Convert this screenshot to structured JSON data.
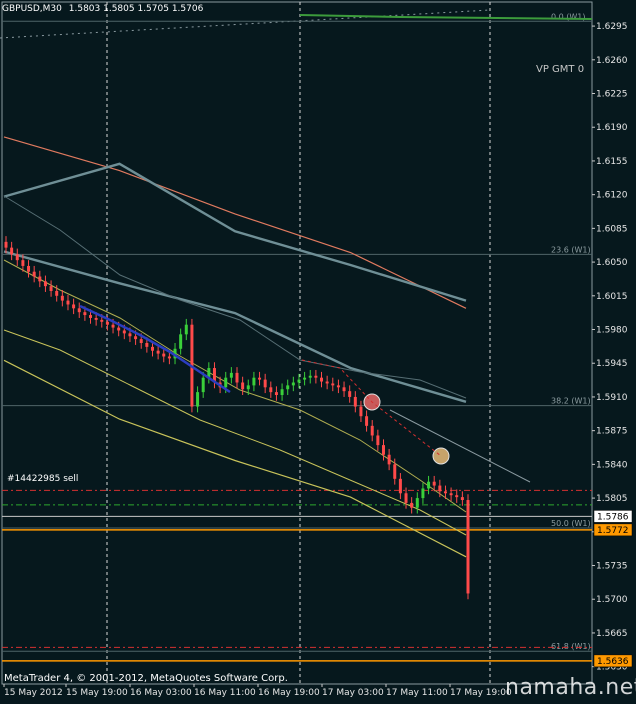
{
  "header": {
    "symbol": "GBPUSD,M30",
    "ohlc": "1.5803 1.5805 1.5705 1.5706"
  },
  "labels": {
    "vp": "VP GMT 0",
    "order": "#14422985 sell",
    "copyright": "MetaTrader 4, © 2001-2012, MetaQuotes Software Corp.",
    "watermark": "namaha.net"
  },
  "fibo": [
    {
      "label": "0.0 (W1)",
      "value": 1.63
    },
    {
      "label": "23.6 (W1)",
      "value": 1.6058
    },
    {
      "label": "38.2 (W1)",
      "value": 1.5901
    },
    {
      "label": "50.0 (W1)",
      "value": 1.5774
    },
    {
      "label": "61.8 (W1)",
      "value": 1.5646
    }
  ],
  "price_boxes": [
    {
      "value": "1.5786",
      "price": 1.5786,
      "bg": "#ffffff",
      "fg": "#000000"
    },
    {
      "value": "1.5772",
      "price": 1.5772,
      "bg": "#ff9900",
      "fg": "#000000"
    },
    {
      "value": "1.5636",
      "price": 1.5636,
      "bg": "#ff9900",
      "fg": "#000000"
    }
  ],
  "chart_data": {
    "type": "candlestick",
    "title": "GBPUSD,M30",
    "ylim": [
      1.5612,
      1.632
    ],
    "y_ticks": [
      "1.6295",
      "1.6260",
      "1.6225",
      "1.6190",
      "1.6155",
      "1.6120",
      "1.6085",
      "1.6050",
      "1.6015",
      "1.5980",
      "1.5945",
      "1.5910",
      "1.5875",
      "1.5840",
      "1.5805",
      "1.5770",
      "1.5735",
      "1.5700",
      "1.5665",
      "1.5630"
    ],
    "x_ticks": [
      "15 May 2012",
      "15 May 19:00",
      "16 May 03:00",
      "16 May 11:00",
      "16 May 19:00",
      "17 May 03:00",
      "17 May 11:00",
      "17 May 19:00"
    ],
    "close": [
      1.6065,
      1.6058,
      1.6052,
      1.6046,
      1.604,
      1.6035,
      1.603,
      1.6025,
      1.602,
      1.6015,
      1.601,
      1.6006,
      1.6002,
      1.5998,
      1.5995,
      1.5992,
      1.599,
      1.5988,
      1.5985,
      1.5982,
      1.5979,
      1.5976,
      1.5973,
      1.597,
      1.5966,
      1.5962,
      1.5958,
      1.5955,
      1.5952,
      1.595,
      1.596,
      1.5975,
      1.5985,
      1.59,
      1.5915,
      1.593,
      1.594,
      1.5925,
      1.592,
      1.593,
      1.5935,
      1.5925,
      1.5918,
      1.5922,
      1.593,
      1.5928,
      1.592,
      1.5915,
      1.5912,
      1.5918,
      1.5922,
      1.5925,
      1.5928,
      1.593,
      1.5932,
      1.593,
      1.5926,
      1.5924,
      1.5922,
      1.592,
      1.5916,
      1.591,
      1.59,
      1.589,
      1.588,
      1.587,
      1.586,
      1.585,
      1.584,
      1.5825,
      1.581,
      1.58,
      1.5795,
      1.5805,
      1.5815,
      1.5822,
      1.5818,
      1.5812,
      1.581,
      1.5808,
      1.5806,
      1.5803,
      1.5706
    ],
    "series": [
      {
        "name": "",
        "color": "#e07a5f",
        "values": [
          1.618,
          1.6145,
          1.61,
          1.606,
          1.6002
        ]
      },
      {
        "name": "",
        "color": "#6f8f96",
        "values": [
          1.6118,
          1.6152,
          1.6082,
          1.6047,
          1.601
        ]
      },
      {
        "name": "",
        "color": "#6f8f96",
        "values": [
          1.6061,
          1.6028,
          1.5997,
          1.594,
          1.5905
        ]
      },
      {
        "name": "",
        "color": "#c8c35a",
        "values": [
          1.5948,
          1.5887,
          1.5844,
          1.5806,
          1.5744
        ]
      }
    ],
    "series_x": [
      0,
      0.25,
      0.5,
      0.75,
      1.0
    ]
  }
}
